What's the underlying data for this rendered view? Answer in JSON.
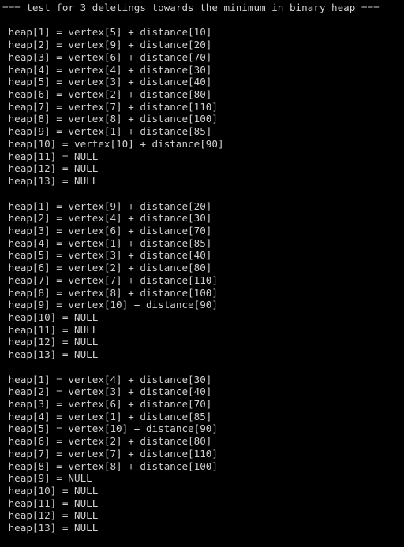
{
  "terminal": {
    "background_color": "#000000",
    "foreground_color": "#d0d0d0",
    "header": "=== test for 3 deletings towards the minimum in binary heap ===",
    "lines": [
      "=== test for 3 deletings towards the minimum in binary heap ===",
      "",
      " heap[1] = vertex[5] + distance[10]",
      " heap[2] = vertex[9] + distance[20]",
      " heap[3] = vertex[6] + distance[70]",
      " heap[4] = vertex[4] + distance[30]",
      " heap[5] = vertex[3] + distance[40]",
      " heap[6] = vertex[2] + distance[80]",
      " heap[7] = vertex[7] + distance[110]",
      " heap[8] = vertex[8] + distance[100]",
      " heap[9] = vertex[1] + distance[85]",
      " heap[10] = vertex[10] + distance[90]",
      " heap[11] = NULL",
      " heap[12] = NULL",
      " heap[13] = NULL",
      "",
      " heap[1] = vertex[9] + distance[20]",
      " heap[2] = vertex[4] + distance[30]",
      " heap[3] = vertex[6] + distance[70]",
      " heap[4] = vertex[1] + distance[85]",
      " heap[5] = vertex[3] + distance[40]",
      " heap[6] = vertex[2] + distance[80]",
      " heap[7] = vertex[7] + distance[110]",
      " heap[8] = vertex[8] + distance[100]",
      " heap[9] = vertex[10] + distance[90]",
      " heap[10] = NULL",
      " heap[11] = NULL",
      " heap[12] = NULL",
      " heap[13] = NULL",
      "",
      " heap[1] = vertex[4] + distance[30]",
      " heap[2] = vertex[3] + distance[40]",
      " heap[3] = vertex[6] + distance[70]",
      " heap[4] = vertex[1] + distance[85]",
      " heap[5] = vertex[10] + distance[90]",
      " heap[6] = vertex[2] + distance[80]",
      " heap[7] = vertex[7] + distance[110]",
      " heap[8] = vertex[8] + distance[100]",
      " heap[9] = NULL",
      " heap[10] = NULL",
      " heap[11] = NULL",
      " heap[12] = NULL",
      " heap[13] = NULL"
    ]
  }
}
